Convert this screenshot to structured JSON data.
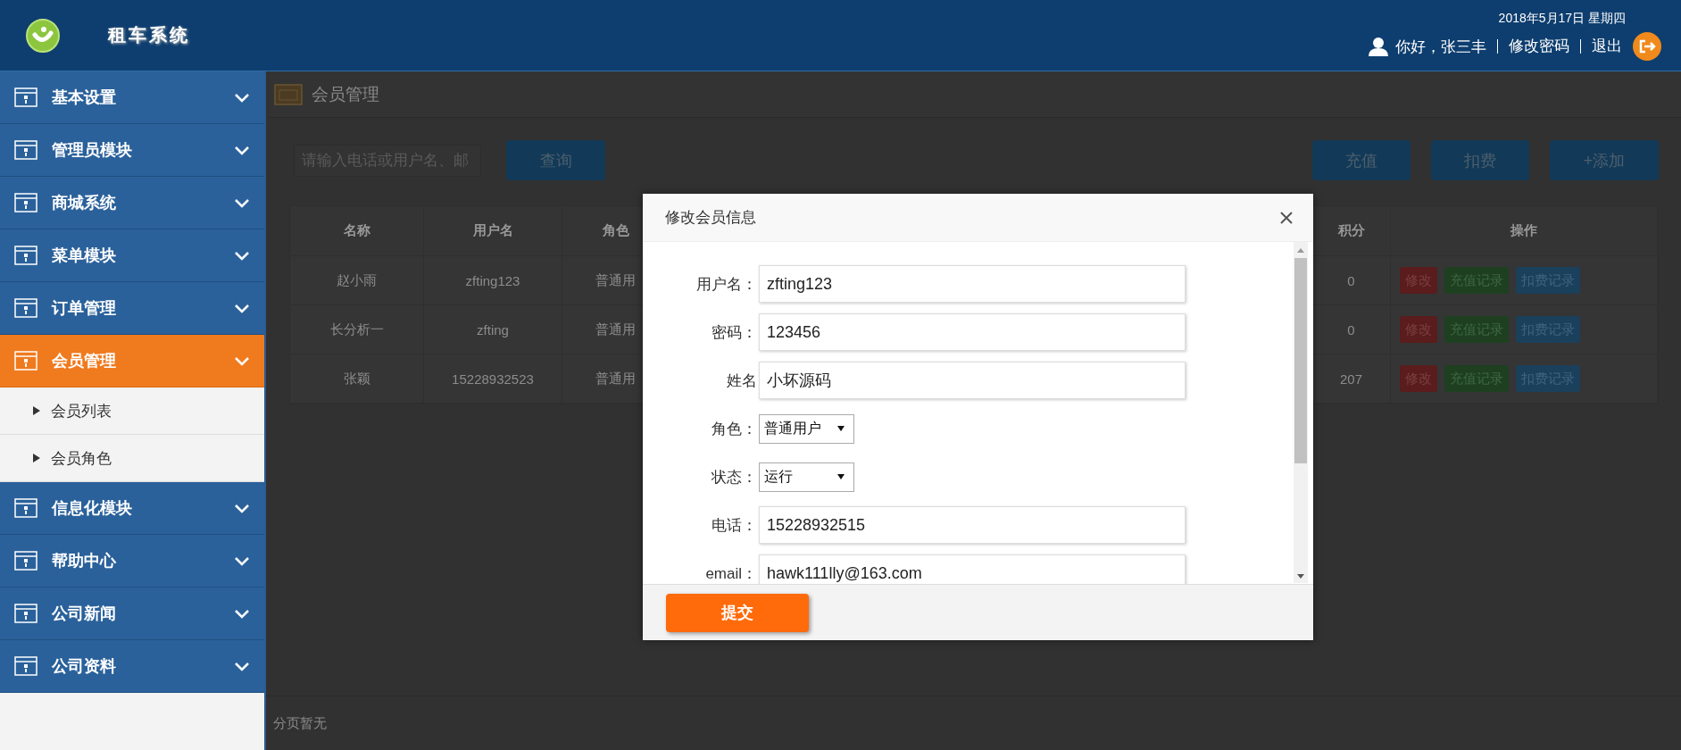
{
  "header": {
    "system_name": "租车系统",
    "date": "2018年5月17日 星期四",
    "greeting": "你好，张三丰",
    "links": [
      "修改密码",
      "退出"
    ]
  },
  "sidebar": {
    "items": [
      {
        "label": "基本设置",
        "selected": false
      },
      {
        "label": "管理员模块",
        "selected": false
      },
      {
        "label": "商城系统",
        "selected": false
      },
      {
        "label": "菜单模块",
        "selected": false
      },
      {
        "label": "订单管理",
        "selected": false
      },
      {
        "label": "会员管理",
        "selected": true,
        "children": [
          {
            "label": "会员列表"
          },
          {
            "label": "会员角色"
          }
        ]
      },
      {
        "label": "信息化模块",
        "selected": false
      },
      {
        "label": "帮助中心",
        "selected": false
      },
      {
        "label": "公司新闻",
        "selected": false
      },
      {
        "label": "公司资料",
        "selected": false
      }
    ]
  },
  "page": {
    "title": "会员管理",
    "search": {
      "placeholder": "请输入电话或用户名、邮"
    },
    "search_button": "查询",
    "actions": [
      "充值",
      "扣费",
      "+添加"
    ]
  },
  "table": {
    "columns": [
      "名称",
      "用户名",
      "角色",
      "积分",
      "操作"
    ],
    "rows": [
      {
        "cells": [
          "赵小雨",
          "zfting123",
          "普通用",
          "0"
        ],
        "actions": [
          {
            "label": "修改",
            "kind": "edit"
          },
          {
            "label": "充值记录",
            "kind": "recharge"
          },
          {
            "label": "扣费记录",
            "kind": "deduct"
          }
        ]
      },
      {
        "cells": [
          "长分析一",
          "zfting",
          "普通用",
          "0"
        ],
        "actions": [
          {
            "label": "修改",
            "kind": "edit"
          },
          {
            "label": "充值记录",
            "kind": "recharge"
          },
          {
            "label": "扣费记录",
            "kind": "deduct"
          }
        ]
      },
      {
        "cells": [
          "张颖",
          "15228932523",
          "普通用",
          "207"
        ],
        "actions": [
          {
            "label": "修改",
            "kind": "edit"
          },
          {
            "label": "充值记录",
            "kind": "recharge"
          },
          {
            "label": "扣费记录",
            "kind": "deduct"
          }
        ]
      }
    ]
  },
  "footer": "分页暂无",
  "dialog": {
    "title": "修改会员信息",
    "fields": [
      {
        "kind": "text",
        "label": "用户名：",
        "value": "zfting123"
      },
      {
        "kind": "text",
        "label": "密码：",
        "value": "123456"
      },
      {
        "kind": "text",
        "label": "姓名",
        "value": "小坏源码"
      },
      {
        "kind": "select",
        "label": "角色：",
        "value": "普通用户"
      },
      {
        "kind": "select",
        "label": "状态：",
        "value": "运行"
      },
      {
        "kind": "text",
        "label": "电话：",
        "value": "15228932515"
      },
      {
        "kind": "text",
        "label": "email：",
        "value": "hawk111lly@163.com"
      }
    ],
    "submit": "提交"
  }
}
